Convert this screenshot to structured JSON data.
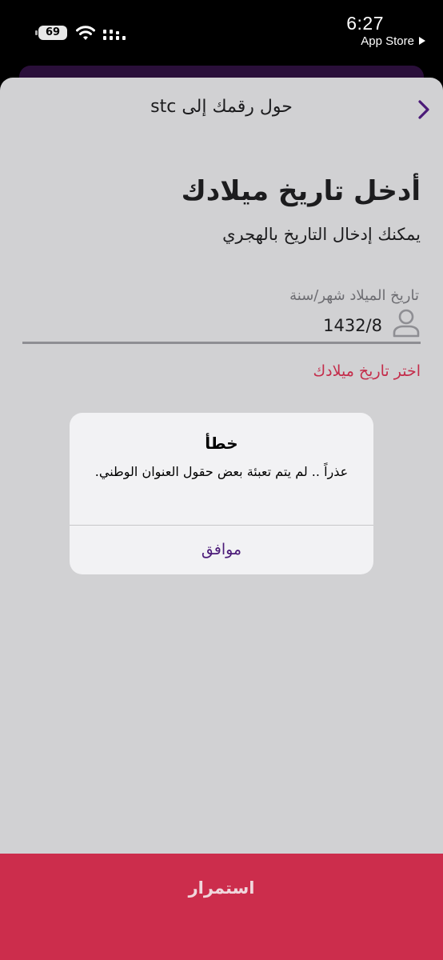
{
  "status_bar": {
    "battery": "69",
    "time": "6:27",
    "back_app": "App Store"
  },
  "nav": {
    "title": "حول رقمك إلى stc",
    "back_icon": "chevron-right-icon"
  },
  "main": {
    "heading": "أدخل تاريخ ميلادك",
    "subheading": "يمكنك إدخال التاريخ بالهجري",
    "field_label": "تاريخ الميلاد شهر/سنة",
    "field_value": "1432/8",
    "field_icon": "person-icon",
    "error_text": "اختر تاريخ ميلادك"
  },
  "alert": {
    "title": "خطأ",
    "message": "عذراً .. لم يتم تعبئة بعض حقول العنوان الوطني.",
    "ok_label": "موافق"
  },
  "footer": {
    "continue_label": "استمرار"
  },
  "colors": {
    "accent_purple": "#4b1a78",
    "error_red": "#c42d4b",
    "button_red": "#cc2d4c",
    "sheet_bg": "#d1d1d3"
  }
}
